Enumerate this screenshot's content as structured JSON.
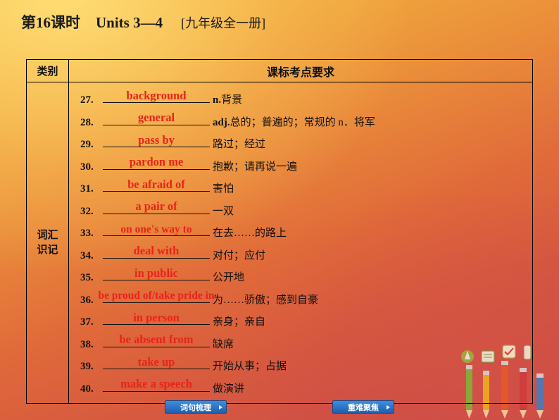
{
  "header": {
    "lesson": "第16课时",
    "units": "Units 3—4",
    "book": "[九年级全一册]"
  },
  "table": {
    "col1_header": "类别",
    "col2_header": "课标考点要求",
    "category_line1": "词汇",
    "category_line2": "识记",
    "rows": [
      {
        "num": "27.",
        "answer": "background",
        "meaning_bold": "n.",
        "meaning": "背景"
      },
      {
        "num": "28.",
        "answer": "general",
        "meaning_bold": "adj.",
        "meaning": "总的；普遍的；常规的   n．将军"
      },
      {
        "num": "29.",
        "answer": "pass by",
        "meaning_bold": "",
        "meaning": "路过；经过"
      },
      {
        "num": "30.",
        "answer": "pardon me",
        "meaning_bold": "",
        "meaning": "抱歉；请再说一遍"
      },
      {
        "num": "31.",
        "answer": "be afraid of",
        "meaning_bold": "",
        "meaning": "害怕"
      },
      {
        "num": "32.",
        "answer": "a pair of",
        "meaning_bold": "",
        "meaning": "一双"
      },
      {
        "num": "33.",
        "answer": "on one's way to",
        "meaning_bold": "",
        "meaning": "在去……的路上"
      },
      {
        "num": "34.",
        "answer": "deal with",
        "meaning_bold": "",
        "meaning": "对付；应付"
      },
      {
        "num": "35.",
        "answer": "in public",
        "meaning_bold": "",
        "meaning": "公开地"
      },
      {
        "num": "36.",
        "answer": "be proud of/take pride in",
        "meaning_bold": "",
        "meaning": "为……骄傲；感到自豪"
      },
      {
        "num": "37.",
        "answer": "in person",
        "meaning_bold": "",
        "meaning": "亲身；亲自"
      },
      {
        "num": "38.",
        "answer": "be absent from",
        "meaning_bold": "",
        "meaning": "缺席"
      },
      {
        "num": "39.",
        "answer": "take up",
        "meaning_bold": "",
        "meaning": "开始从事；占据"
      },
      {
        "num": "40.",
        "answer": "make a speech",
        "meaning_bold": "",
        "meaning": "做演讲"
      }
    ]
  },
  "buttons": [
    {
      "label": "词句梳理"
    },
    {
      "label": "重难聚焦"
    }
  ],
  "colors": {
    "answer_red": "#e8231a",
    "button_blue": "#1e5fae",
    "text_black": "#111111"
  }
}
